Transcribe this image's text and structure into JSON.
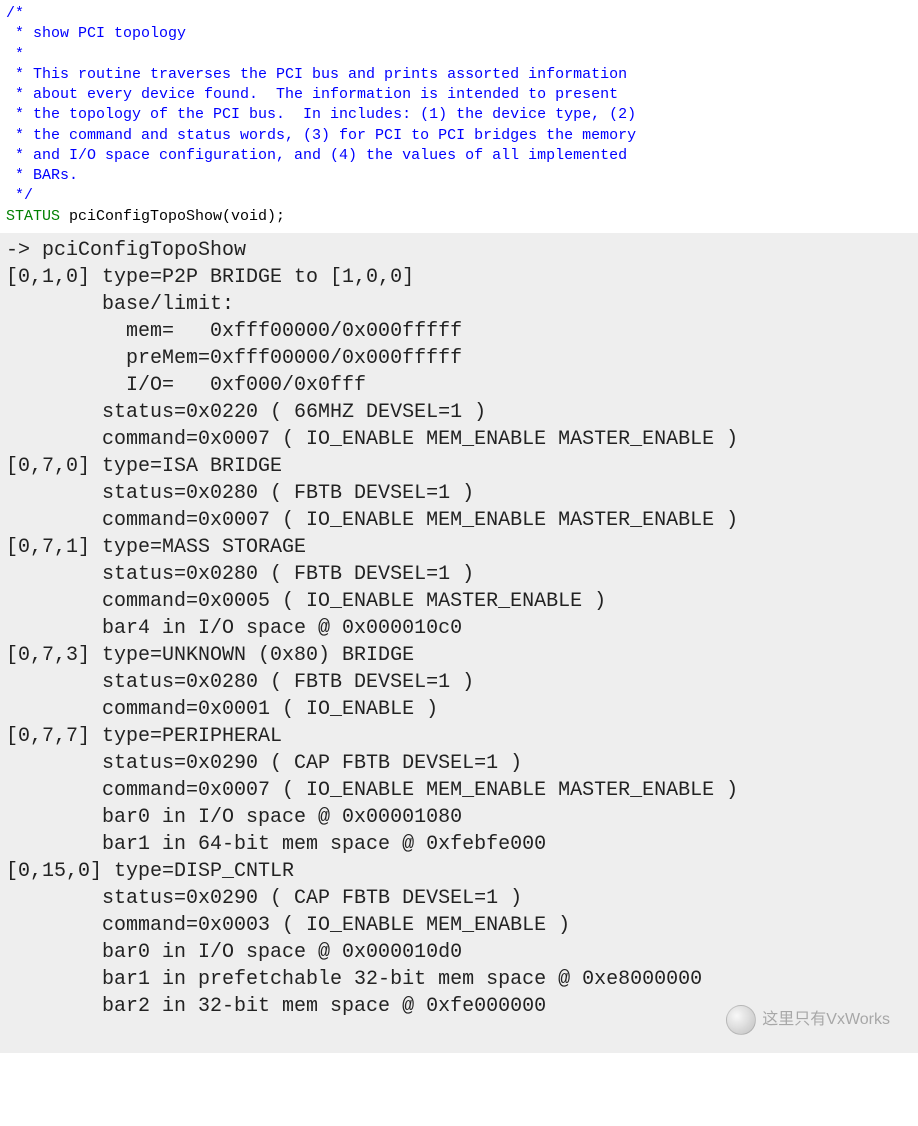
{
  "source": {
    "comment_lines": [
      "/*",
      " * show PCI topology",
      " *",
      " * This routine traverses the PCI bus and prints assorted information",
      " * about every device found.  The information is intended to present",
      " * the topology of the PCI bus.  In includes: (1) the device type, (2)",
      " * the command and status words, (3) for PCI to PCI bridges the memory",
      " * and I/O space configuration, and (4) the values of all implemented",
      " * BARs.",
      " */"
    ],
    "decl_keyword": "STATUS",
    "decl_rest": " pciConfigTopoShow(void);"
  },
  "terminal": {
    "lines": [
      "-> pciConfigTopoShow",
      "[0,1,0] type=P2P BRIDGE to [1,0,0]",
      "        base/limit:",
      "          mem=   0xfff00000/0x000fffff",
      "          preMem=0xfff00000/0x000fffff",
      "          I/O=   0xf000/0x0fff",
      "        status=0x0220 ( 66MHZ DEVSEL=1 )",
      "        command=0x0007 ( IO_ENABLE MEM_ENABLE MASTER_ENABLE )",
      "[0,7,0] type=ISA BRIDGE",
      "        status=0x0280 ( FBTB DEVSEL=1 )",
      "        command=0x0007 ( IO_ENABLE MEM_ENABLE MASTER_ENABLE )",
      "[0,7,1] type=MASS STORAGE",
      "        status=0x0280 ( FBTB DEVSEL=1 )",
      "        command=0x0005 ( IO_ENABLE MASTER_ENABLE )",
      "        bar4 in I/O space @ 0x000010c0",
      "[0,7,3] type=UNKNOWN (0x80) BRIDGE",
      "        status=0x0280 ( FBTB DEVSEL=1 )",
      "        command=0x0001 ( IO_ENABLE )",
      "[0,7,7] type=PERIPHERAL",
      "        status=0x0290 ( CAP FBTB DEVSEL=1 )",
      "        command=0x0007 ( IO_ENABLE MEM_ENABLE MASTER_ENABLE )",
      "        bar0 in I/O space @ 0x00001080",
      "        bar1 in 64-bit mem space @ 0xfebfe000",
      "[0,15,0] type=DISP_CNTLR",
      "        status=0x0290 ( CAP FBTB DEVSEL=1 )",
      "        command=0x0003 ( IO_ENABLE MEM_ENABLE )",
      "        bar0 in I/O space @ 0x000010d0",
      "        bar1 in prefetchable 32-bit mem space @ 0xe8000000",
      "        bar2 in 32-bit mem space @ 0xfe000000"
    ]
  },
  "watermark_text": "这里只有VxWorks"
}
